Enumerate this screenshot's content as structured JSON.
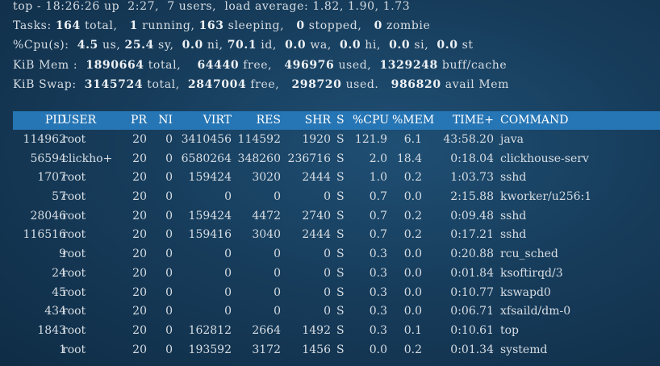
{
  "summary": {
    "line1": "top - 18:26:26 up  2:27,  7 users,  load average: 1.82, 1.90, 1.73",
    "tasks": {
      "label": "Tasks:",
      "total": "164",
      "total_label": "total,",
      "running": "1",
      "running_label": "running,",
      "sleeping": "163",
      "sleeping_label": "sleeping,",
      "stopped": "0",
      "stopped_label": "stopped,",
      "zombie": "0",
      "zombie_label": "zombie"
    },
    "cpu": {
      "label": "%Cpu(s):",
      "us": "4.5",
      "us_label": "us,",
      "sy": "25.4",
      "sy_label": "sy,",
      "ni": "0.0",
      "ni_label": "ni,",
      "id": "70.1",
      "id_label": "id,",
      "wa": "0.0",
      "wa_label": "wa,",
      "hi": "0.0",
      "hi_label": "hi,",
      "si": "0.0",
      "si_label": "si,",
      "st": "0.0",
      "st_label": "st"
    },
    "mem": {
      "label": "KiB Mem :",
      "total": "1890664",
      "total_label": "total,",
      "free": "64440",
      "free_label": "free,",
      "used": "496976",
      "used_label": "used,",
      "cache": "1329248",
      "cache_label": "buff/cache"
    },
    "swap": {
      "label": "KiB Swap:",
      "total": "3145724",
      "total_label": "total,",
      "free": "2847004",
      "free_label": "free,",
      "used": "298720",
      "used_label": "used.",
      "avail": "986820",
      "avail_label": "avail Mem"
    }
  },
  "table": {
    "headers": {
      "pid": "PID",
      "user": "USER",
      "pr": "PR",
      "ni": "NI",
      "virt": "VIRT",
      "res": "RES",
      "shr": "SHR",
      "s": "S",
      "cpu": "%CPU",
      "mem": "%MEM",
      "time": "TIME+",
      "command": "COMMAND"
    },
    "rows": [
      {
        "pid": "114962",
        "user": "root",
        "pr": "20",
        "ni": "0",
        "virt": "3410456",
        "res": "114592",
        "shr": "1920",
        "s": "S",
        "cpu": "121.9",
        "mem": "6.1",
        "time": "43:58.20",
        "command": "java"
      },
      {
        "pid": "56594",
        "user": "clickho+",
        "pr": "20",
        "ni": "0",
        "virt": "6580264",
        "res": "348260",
        "shr": "236716",
        "s": "S",
        "cpu": "2.0",
        "mem": "18.4",
        "time": "0:18.04",
        "command": "clickhouse-serv"
      },
      {
        "pid": "1707",
        "user": "root",
        "pr": "20",
        "ni": "0",
        "virt": "159424",
        "res": "3020",
        "shr": "2444",
        "s": "S",
        "cpu": "1.0",
        "mem": "0.2",
        "time": "1:03.73",
        "command": "sshd"
      },
      {
        "pid": "57",
        "user": "root",
        "pr": "20",
        "ni": "0",
        "virt": "0",
        "res": "0",
        "shr": "0",
        "s": "S",
        "cpu": "0.7",
        "mem": "0.0",
        "time": "2:15.88",
        "command": "kworker/u256:1"
      },
      {
        "pid": "28046",
        "user": "root",
        "pr": "20",
        "ni": "0",
        "virt": "159424",
        "res": "4472",
        "shr": "2740",
        "s": "S",
        "cpu": "0.7",
        "mem": "0.2",
        "time": "0:09.48",
        "command": "sshd"
      },
      {
        "pid": "116516",
        "user": "root",
        "pr": "20",
        "ni": "0",
        "virt": "159416",
        "res": "3040",
        "shr": "2444",
        "s": "S",
        "cpu": "0.7",
        "mem": "0.2",
        "time": "0:17.21",
        "command": "sshd"
      },
      {
        "pid": "9",
        "user": "root",
        "pr": "20",
        "ni": "0",
        "virt": "0",
        "res": "0",
        "shr": "0",
        "s": "S",
        "cpu": "0.3",
        "mem": "0.0",
        "time": "0:20.88",
        "command": "rcu_sched"
      },
      {
        "pid": "24",
        "user": "root",
        "pr": "20",
        "ni": "0",
        "virt": "0",
        "res": "0",
        "shr": "0",
        "s": "S",
        "cpu": "0.3",
        "mem": "0.0",
        "time": "0:01.84",
        "command": "ksoftirqd/3"
      },
      {
        "pid": "45",
        "user": "root",
        "pr": "20",
        "ni": "0",
        "virt": "0",
        "res": "0",
        "shr": "0",
        "s": "S",
        "cpu": "0.3",
        "mem": "0.0",
        "time": "0:10.77",
        "command": "kswapd0"
      },
      {
        "pid": "434",
        "user": "root",
        "pr": "20",
        "ni": "0",
        "virt": "0",
        "res": "0",
        "shr": "0",
        "s": "S",
        "cpu": "0.3",
        "mem": "0.0",
        "time": "0:06.71",
        "command": "xfsaild/dm-0"
      },
      {
        "pid": "1843",
        "user": "root",
        "pr": "20",
        "ni": "0",
        "virt": "162812",
        "res": "2664",
        "shr": "1492",
        "s": "S",
        "cpu": "0.3",
        "mem": "0.1",
        "time": "0:10.61",
        "command": "top"
      },
      {
        "pid": "1",
        "user": "root",
        "pr": "20",
        "ni": "0",
        "virt": "193592",
        "res": "3172",
        "shr": "1456",
        "s": "S",
        "cpu": "0.0",
        "mem": "0.2",
        "time": "0:01.34",
        "command": "systemd"
      }
    ]
  },
  "colors": {
    "background": "#173d5c",
    "header_bar": "#2675b4",
    "text": "#d7dde3"
  }
}
